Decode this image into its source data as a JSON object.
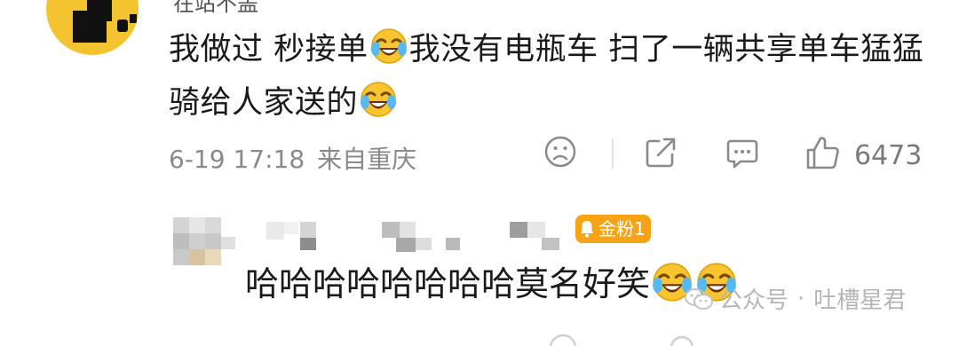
{
  "comment": {
    "username": "在站不盖",
    "text_part1": "我做过 秒接单",
    "text_part2": "我没有电瓶车 扫了一辆共享单车猛猛骑给人家送的",
    "emoji_icon": "laugh-cry-emoji",
    "date": "6-19 17:18",
    "location": "来自重庆",
    "like_count": "6473"
  },
  "reply": {
    "badge_label": "金粉1",
    "text": "哈哈哈哈哈哈哈哈莫名好笑",
    "emoji_icon": "laugh-cry-emoji"
  },
  "watermark": {
    "brand": "公众号",
    "separator": "·",
    "account": "吐槽星君"
  },
  "colors": {
    "avatar_bg": "#f4c430",
    "badge_bg": "#f6a316",
    "meta_text": "#8a8a8a"
  }
}
